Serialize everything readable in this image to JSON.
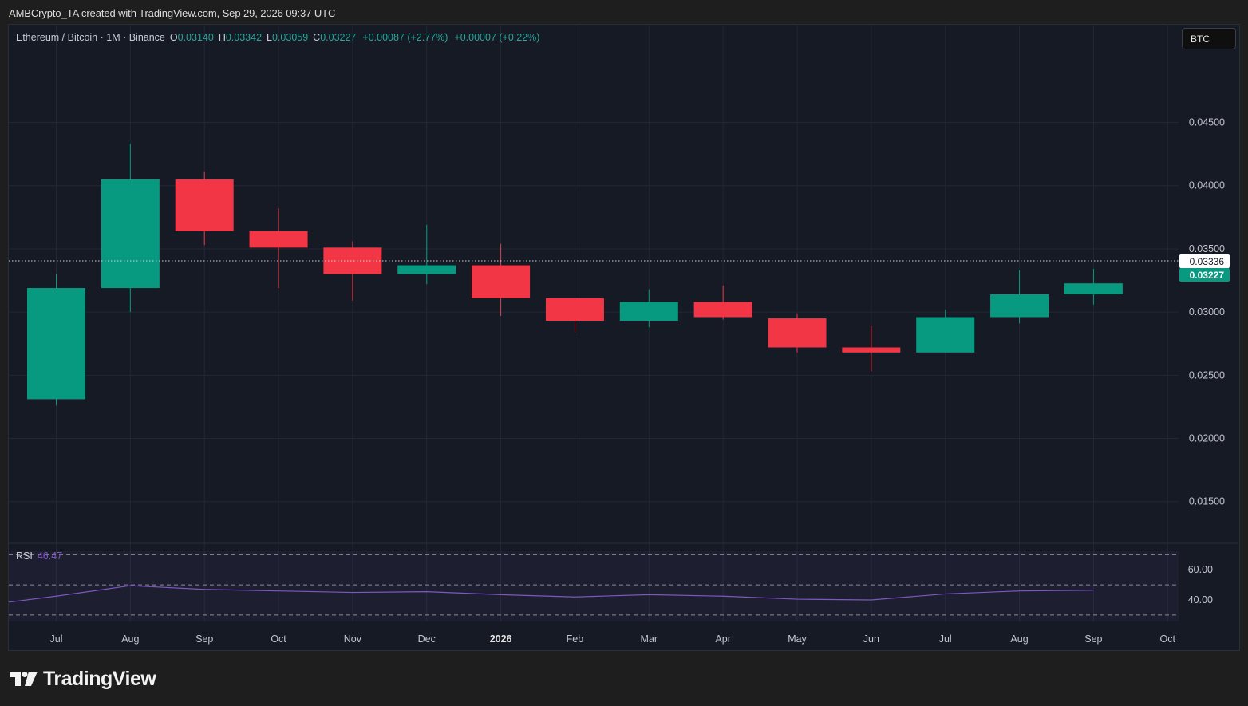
{
  "header": {
    "attribution": "AMBCrypto_TA created with TradingView.com, Sep 29, 2026 09:37 UTC"
  },
  "legend": {
    "symbol": "Ethereum / Bitcoin · 1M · Binance",
    "open_label": "O",
    "open": "0.03140",
    "high_label": "H",
    "high": "0.03342",
    "low_label": "L",
    "low": "0.03059",
    "close_label": "C",
    "close": "0.03227",
    "change": "+0.00087 (+2.77%)",
    "change2": "+0.00007 (+0.22%)"
  },
  "currency_button": "BTC",
  "price_labels": {
    "crosshair": "0.03336",
    "last": "0.03227"
  },
  "rsi": {
    "label": "RSI",
    "value": "46.47"
  },
  "brand": {
    "name": "TradingView",
    "icon": "tradingview-logo-icon"
  },
  "colors": {
    "up": "#089981",
    "down": "#f23645",
    "rsi_line": "#7e57c2",
    "background": "#161a25",
    "grid": "#232735"
  },
  "chart_data": [
    {
      "type": "candlestick",
      "title": "Ethereum / Bitcoin · 1M · Binance",
      "x": [
        "Jul",
        "Aug",
        "Sep",
        "Oct",
        "Nov",
        "Dec",
        "2026",
        "Feb",
        "Mar",
        "Apr",
        "May",
        "Jun",
        "Jul",
        "Aug",
        "Sep"
      ],
      "x_ticks": [
        "Jul",
        "Aug",
        "Sep",
        "Oct",
        "Nov",
        "Dec",
        "2026",
        "Feb",
        "Mar",
        "Apr",
        "May",
        "Jun",
        "Jul",
        "Aug",
        "Sep",
        "Oct"
      ],
      "open": [
        0.0231,
        0.0319,
        0.0405,
        0.0364,
        0.0351,
        0.033,
        0.0337,
        0.0311,
        0.0293,
        0.0308,
        0.0295,
        0.0272,
        0.0268,
        0.0296,
        0.0314
      ],
      "high": [
        0.033,
        0.0433,
        0.0411,
        0.0382,
        0.0356,
        0.0369,
        0.0354,
        0.0311,
        0.0318,
        0.0321,
        0.0299,
        0.0289,
        0.0302,
        0.0333,
        0.03342
      ],
      "low": [
        0.0226,
        0.03,
        0.0353,
        0.0319,
        0.0309,
        0.0322,
        0.0297,
        0.0284,
        0.0288,
        0.0294,
        0.0268,
        0.0253,
        0.0268,
        0.0291,
        0.03059
      ],
      "close": [
        0.0319,
        0.0405,
        0.0364,
        0.0351,
        0.033,
        0.0337,
        0.0311,
        0.0293,
        0.0308,
        0.0296,
        0.0272,
        0.0268,
        0.0296,
        0.0314,
        0.03227
      ],
      "y_ticks": [
        "0.04500",
        "0.04000",
        "0.03500",
        "0.03000",
        "0.02500",
        "0.02000",
        "0.01500"
      ],
      "ylim": [
        0.0117,
        0.0528
      ],
      "grid": true
    },
    {
      "type": "line",
      "title": "RSI",
      "x": [
        "Jul",
        "Aug",
        "Sep",
        "Oct",
        "Nov",
        "Dec",
        "2026",
        "Feb",
        "Mar",
        "Apr",
        "May",
        "Jun",
        "Jul",
        "Aug",
        "Sep"
      ],
      "values": [
        42.5,
        49.5,
        47.0,
        46.0,
        45.0,
        45.5,
        43.5,
        42.0,
        43.5,
        42.5,
        40.5,
        40.0,
        44.0,
        46.0,
        46.47
      ],
      "y_ticks": [
        "60.00",
        "40.00"
      ],
      "bands": [
        70,
        50,
        30
      ],
      "ylim": [
        25.7,
        72.3
      ]
    }
  ]
}
